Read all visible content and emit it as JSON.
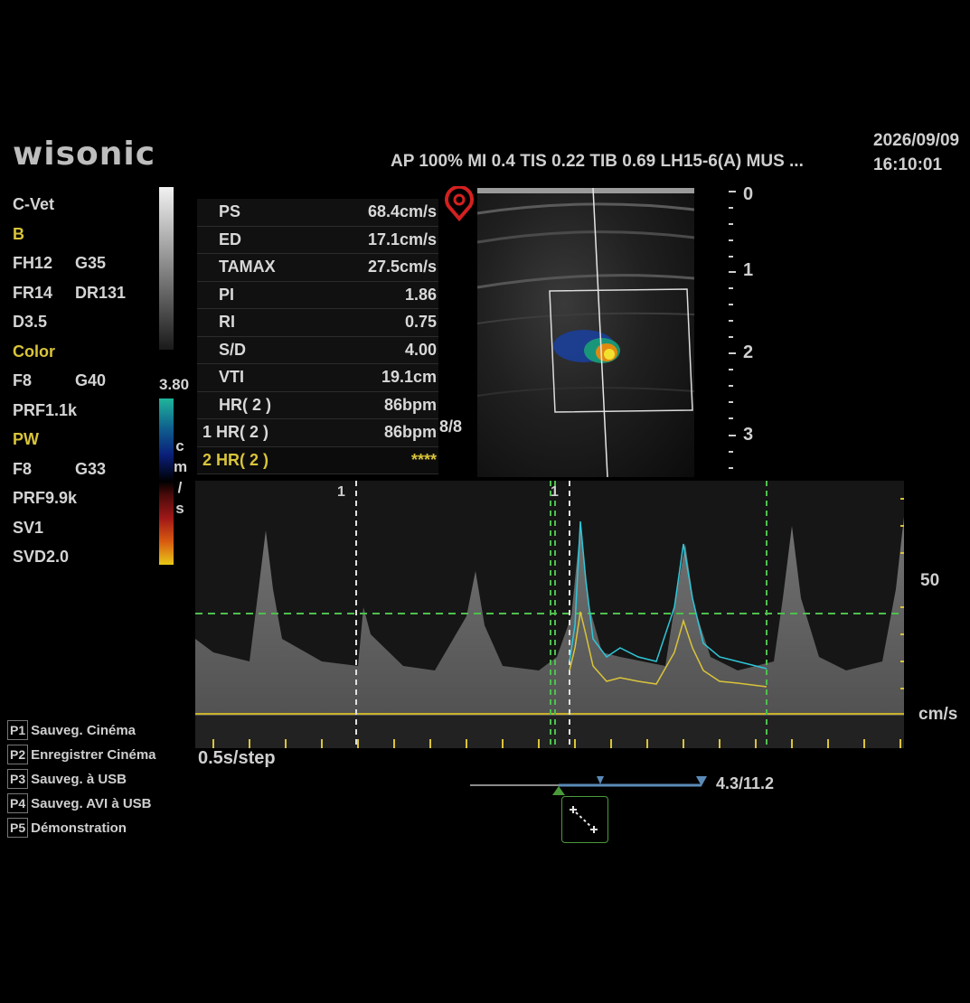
{
  "brand": "wisonic",
  "header": {
    "params": "AP 100% MI 0.4 TIS 0.22  TIB 0.69  LH15-6(A)  MUS ...",
    "date": "2026/09/09",
    "time": "16:10:01"
  },
  "sidebar": {
    "app": "C-Vet",
    "b_mode": "B",
    "b_params": [
      [
        "FH12",
        "G35"
      ],
      [
        "FR14",
        "DR131"
      ],
      [
        "D3.5",
        ""
      ]
    ],
    "color_mode": "Color",
    "color_params": [
      [
        "F8",
        "G40"
      ],
      [
        "PRF1.1k",
        ""
      ]
    ],
    "pw_mode": "PW",
    "pw_params": [
      [
        "F8",
        "G33"
      ],
      [
        "PRF9.9k",
        ""
      ],
      [
        "SV1",
        ""
      ],
      [
        "SVD2.0",
        ""
      ]
    ]
  },
  "color_scale": {
    "max": "3.80",
    "unit_letters": [
      "c",
      "m",
      "/",
      "s"
    ]
  },
  "measurements": [
    {
      "label": "PS",
      "value": "68.4cm/s"
    },
    {
      "label": "ED",
      "value": "17.1cm/s"
    },
    {
      "label": "TAMAX",
      "value": "27.5cm/s"
    },
    {
      "label": "PI",
      "value": "1.86"
    },
    {
      "label": "RI",
      "value": "0.75"
    },
    {
      "label": "S/D",
      "value": "4.00"
    },
    {
      "label": "VTI",
      "value": "19.1cm"
    },
    {
      "label": "HR( 2 )",
      "value": "86bpm"
    },
    {
      "label": "1 HR( 2 )",
      "value": "86bpm"
    },
    {
      "label": "2 HR( 2 )",
      "value": "****"
    }
  ],
  "measurement_count": "8/8",
  "depth_labels": [
    "0",
    "1",
    "2",
    "3"
  ],
  "doppler": {
    "scale_label": "50",
    "unit": "cm/s",
    "cycle_marker": "1",
    "cycle_marker_2": "1",
    "sweep": "0.5s/step"
  },
  "presets": [
    {
      "key": "P1",
      "label": "Sauveg. Cinéma"
    },
    {
      "key": "P2",
      "label": "Enregistrer Cinéma"
    },
    {
      "key": "P3",
      "label": "Sauveg. à USB"
    },
    {
      "key": "P4",
      "label": "Sauveg. AVI à USB"
    },
    {
      "key": "P5",
      "label": "Démonstration"
    }
  ],
  "cine": {
    "frame": "4.3/11.2"
  },
  "colors": {
    "accent_yellow": "#d9c43a",
    "trace_cyan": "#2fc6d8",
    "marker_green": "#4ec04e",
    "probe_red": "#d42020"
  }
}
